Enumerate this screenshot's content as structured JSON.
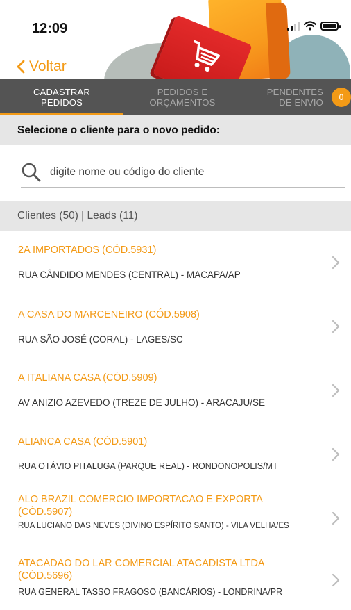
{
  "status": {
    "time": "12:09"
  },
  "nav": {
    "back_label": "Voltar"
  },
  "tabs": [
    {
      "line1": "CADASTRAR",
      "line2": "PEDIDOS",
      "active": true
    },
    {
      "line1": "PEDIDOS E",
      "line2": "ORÇAMENTOS",
      "active": false
    },
    {
      "line1": "PENDENTES",
      "line2": "DE ENVIO",
      "active": false,
      "badge": "0"
    }
  ],
  "section": {
    "title": "Selecione o cliente para o novo pedido:"
  },
  "search": {
    "placeholder": "digite nome ou código do cliente",
    "value": ""
  },
  "counts": {
    "label": "Clientes (50) | Leads (11)"
  },
  "clients": [
    {
      "name": "2A IMPORTADOS (CÓD.5931)",
      "address": "RUA CÂNDIDO MENDES (CENTRAL) - MACAPA/AP"
    },
    {
      "name": "A CASA DO MARCENEIRO (CÓD.5908)",
      "address": "RUA SÃO JOSÉ (CORAL) - LAGES/SC"
    },
    {
      "name": "A ITALIANA CASA (CÓD.5909)",
      "address": "AV ANIZIO AZEVEDO (TREZE DE JULHO) - ARACAJU/SE"
    },
    {
      "name": "ALIANCA CASA (CÓD.5901)",
      "address": "RUA OTÁVIO PITALUGA (PARQUE REAL) - RONDONOPOLIS/MT"
    },
    {
      "name": "ALO BRAZIL COMERCIO IMPORTACAO E EXPORTA (CÓD.5907)",
      "address": "RUA LUCIANO DAS NEVES (DIVINO ESPÍRITO SANTO) - VILA VELHA/ES"
    },
    {
      "name": "ATACADAO DO LAR COMERCIAL ATACADISTA LTDA (CÓD.5696)",
      "address": "RUA GENERAL TASSO FRAGOSO (BANCÁRIOS) - LONDRINA/PR"
    }
  ],
  "colors": {
    "accent": "#f39a16",
    "tab_bar": "#545454",
    "section_bg": "#e6e6e6"
  }
}
